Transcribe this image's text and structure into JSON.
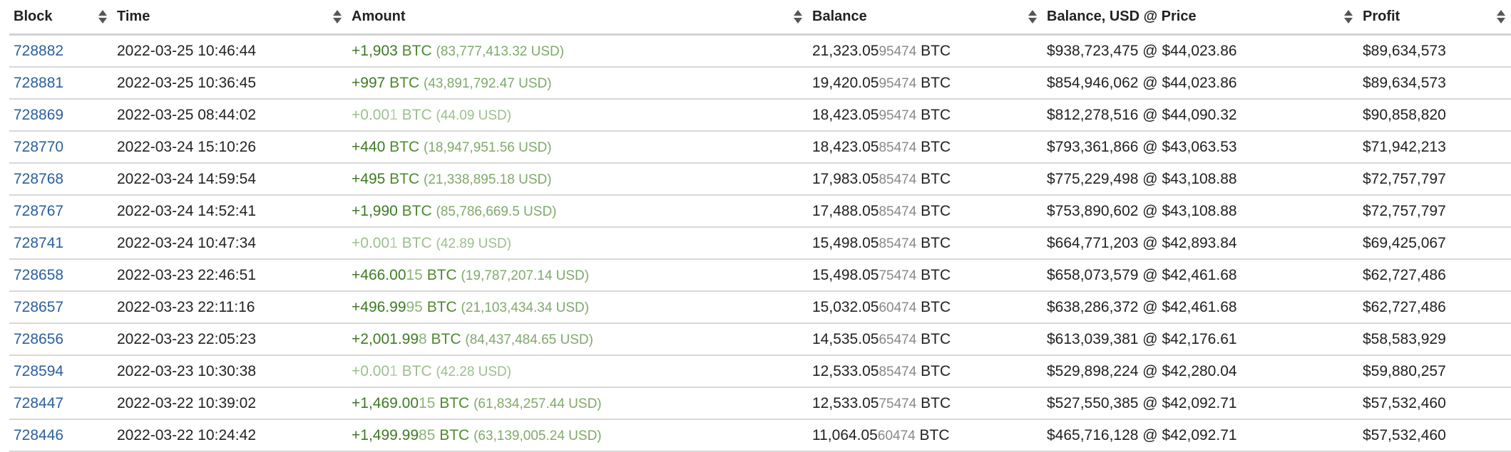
{
  "headers": {
    "block": "Block",
    "time": "Time",
    "amount": "Amount",
    "balance": "Balance",
    "balance_usd": "Balance, USD @ Price",
    "profit": "Profit"
  },
  "rows": [
    {
      "block": "728882",
      "time": "2022-03-25 10:46:44",
      "amount_main": "+1,903",
      "amount_dim": "",
      "amount_unit": " BTC",
      "amount_usd": "(83,777,413.32 USD)",
      "balance_main": "21,323.05",
      "balance_dim": "95474",
      "balance_unit": " BTC",
      "balance_usd": "$938,723,475 @ $44,023.86",
      "profit": "$89,634,573",
      "tiny": false
    },
    {
      "block": "728881",
      "time": "2022-03-25 10:36:45",
      "amount_main": "+997",
      "amount_dim": "",
      "amount_unit": " BTC",
      "amount_usd": "(43,891,792.47 USD)",
      "balance_main": "19,420.05",
      "balance_dim": "95474",
      "balance_unit": " BTC",
      "balance_usd": "$854,946,062 @ $44,023.86",
      "profit": "$89,634,573",
      "tiny": false
    },
    {
      "block": "728869",
      "time": "2022-03-25 08:44:02",
      "amount_main": "+0.00",
      "amount_dim": "1",
      "amount_unit": " BTC",
      "amount_usd": "(44.09 USD)",
      "balance_main": "18,423.05",
      "balance_dim": "95474",
      "balance_unit": " BTC",
      "balance_usd": "$812,278,516 @ $44,090.32",
      "profit": "$90,858,820",
      "tiny": true
    },
    {
      "block": "728770",
      "time": "2022-03-24 15:10:26",
      "amount_main": "+440",
      "amount_dim": "",
      "amount_unit": " BTC",
      "amount_usd": "(18,947,951.56 USD)",
      "balance_main": "18,423.05",
      "balance_dim": "85474",
      "balance_unit": " BTC",
      "balance_usd": "$793,361,866 @ $43,063.53",
      "profit": "$71,942,213",
      "tiny": false
    },
    {
      "block": "728768",
      "time": "2022-03-24 14:59:54",
      "amount_main": "+495",
      "amount_dim": "",
      "amount_unit": " BTC",
      "amount_usd": "(21,338,895.18 USD)",
      "balance_main": "17,983.05",
      "balance_dim": "85474",
      "balance_unit": " BTC",
      "balance_usd": "$775,229,498 @ $43,108.88",
      "profit": "$72,757,797",
      "tiny": false
    },
    {
      "block": "728767",
      "time": "2022-03-24 14:52:41",
      "amount_main": "+1,990",
      "amount_dim": "",
      "amount_unit": " BTC",
      "amount_usd": "(85,786,669.5 USD)",
      "balance_main": "17,488.05",
      "balance_dim": "85474",
      "balance_unit": " BTC",
      "balance_usd": "$753,890,602 @ $43,108.88",
      "profit": "$72,757,797",
      "tiny": false
    },
    {
      "block": "728741",
      "time": "2022-03-24 10:47:34",
      "amount_main": "+0.00",
      "amount_dim": "1",
      "amount_unit": " BTC",
      "amount_usd": "(42.89 USD)",
      "balance_main": "15,498.05",
      "balance_dim": "85474",
      "balance_unit": " BTC",
      "balance_usd": "$664,771,203 @ $42,893.84",
      "profit": "$69,425,067",
      "tiny": true
    },
    {
      "block": "728658",
      "time": "2022-03-23 22:46:51",
      "amount_main": "+466.00",
      "amount_dim": "15",
      "amount_unit": " BTC",
      "amount_usd": "(19,787,207.14 USD)",
      "balance_main": "15,498.05",
      "balance_dim": "75474",
      "balance_unit": " BTC",
      "balance_usd": "$658,073,579 @ $42,461.68",
      "profit": "$62,727,486",
      "tiny": false
    },
    {
      "block": "728657",
      "time": "2022-03-23 22:11:16",
      "amount_main": "+496.99",
      "amount_dim": "95",
      "amount_unit": " BTC",
      "amount_usd": "(21,103,434.34 USD)",
      "balance_main": "15,032.05",
      "balance_dim": "60474",
      "balance_unit": " BTC",
      "balance_usd": "$638,286,372 @ $42,461.68",
      "profit": "$62,727,486",
      "tiny": false
    },
    {
      "block": "728656",
      "time": "2022-03-23 22:05:23",
      "amount_main": "+2,001.99",
      "amount_dim": "8",
      "amount_unit": " BTC",
      "amount_usd": "(84,437,484.65 USD)",
      "balance_main": "14,535.05",
      "balance_dim": "65474",
      "balance_unit": " BTC",
      "balance_usd": "$613,039,381 @ $42,176.61",
      "profit": "$58,583,929",
      "tiny": false
    },
    {
      "block": "728594",
      "time": "2022-03-23 10:30:38",
      "amount_main": "+0.00",
      "amount_dim": "1",
      "amount_unit": " BTC",
      "amount_usd": "(42.28 USD)",
      "balance_main": "12,533.05",
      "balance_dim": "85474",
      "balance_unit": " BTC",
      "balance_usd": "$529,898,224 @ $42,280.04",
      "profit": "$59,880,257",
      "tiny": true
    },
    {
      "block": "728447",
      "time": "2022-03-22 10:39:02",
      "amount_main": "+1,469.00",
      "amount_dim": "15",
      "amount_unit": " BTC",
      "amount_usd": "(61,834,257.44 USD)",
      "balance_main": "12,533.05",
      "balance_dim": "75474",
      "balance_unit": " BTC",
      "balance_usd": "$527,550,385 @ $42,092.71",
      "profit": "$57,532,460",
      "tiny": false
    },
    {
      "block": "728446",
      "time": "2022-03-22 10:24:42",
      "amount_main": "+1,499.99",
      "amount_dim": "85",
      "amount_unit": " BTC",
      "amount_usd": "(63,139,005.24 USD)",
      "balance_main": "11,064.05",
      "balance_dim": "60474",
      "balance_unit": " BTC",
      "balance_usd": "$465,716,128 @ $42,092.71",
      "profit": "$57,532,460",
      "tiny": false
    }
  ],
  "colors": {
    "link": "#2b5ea0",
    "amount_green": "#4e8a2e",
    "amount_faded": "#9cbf8d",
    "row_border": "#d8d8d8"
  },
  "icons": {
    "sort": "sort-arrows-icon"
  }
}
